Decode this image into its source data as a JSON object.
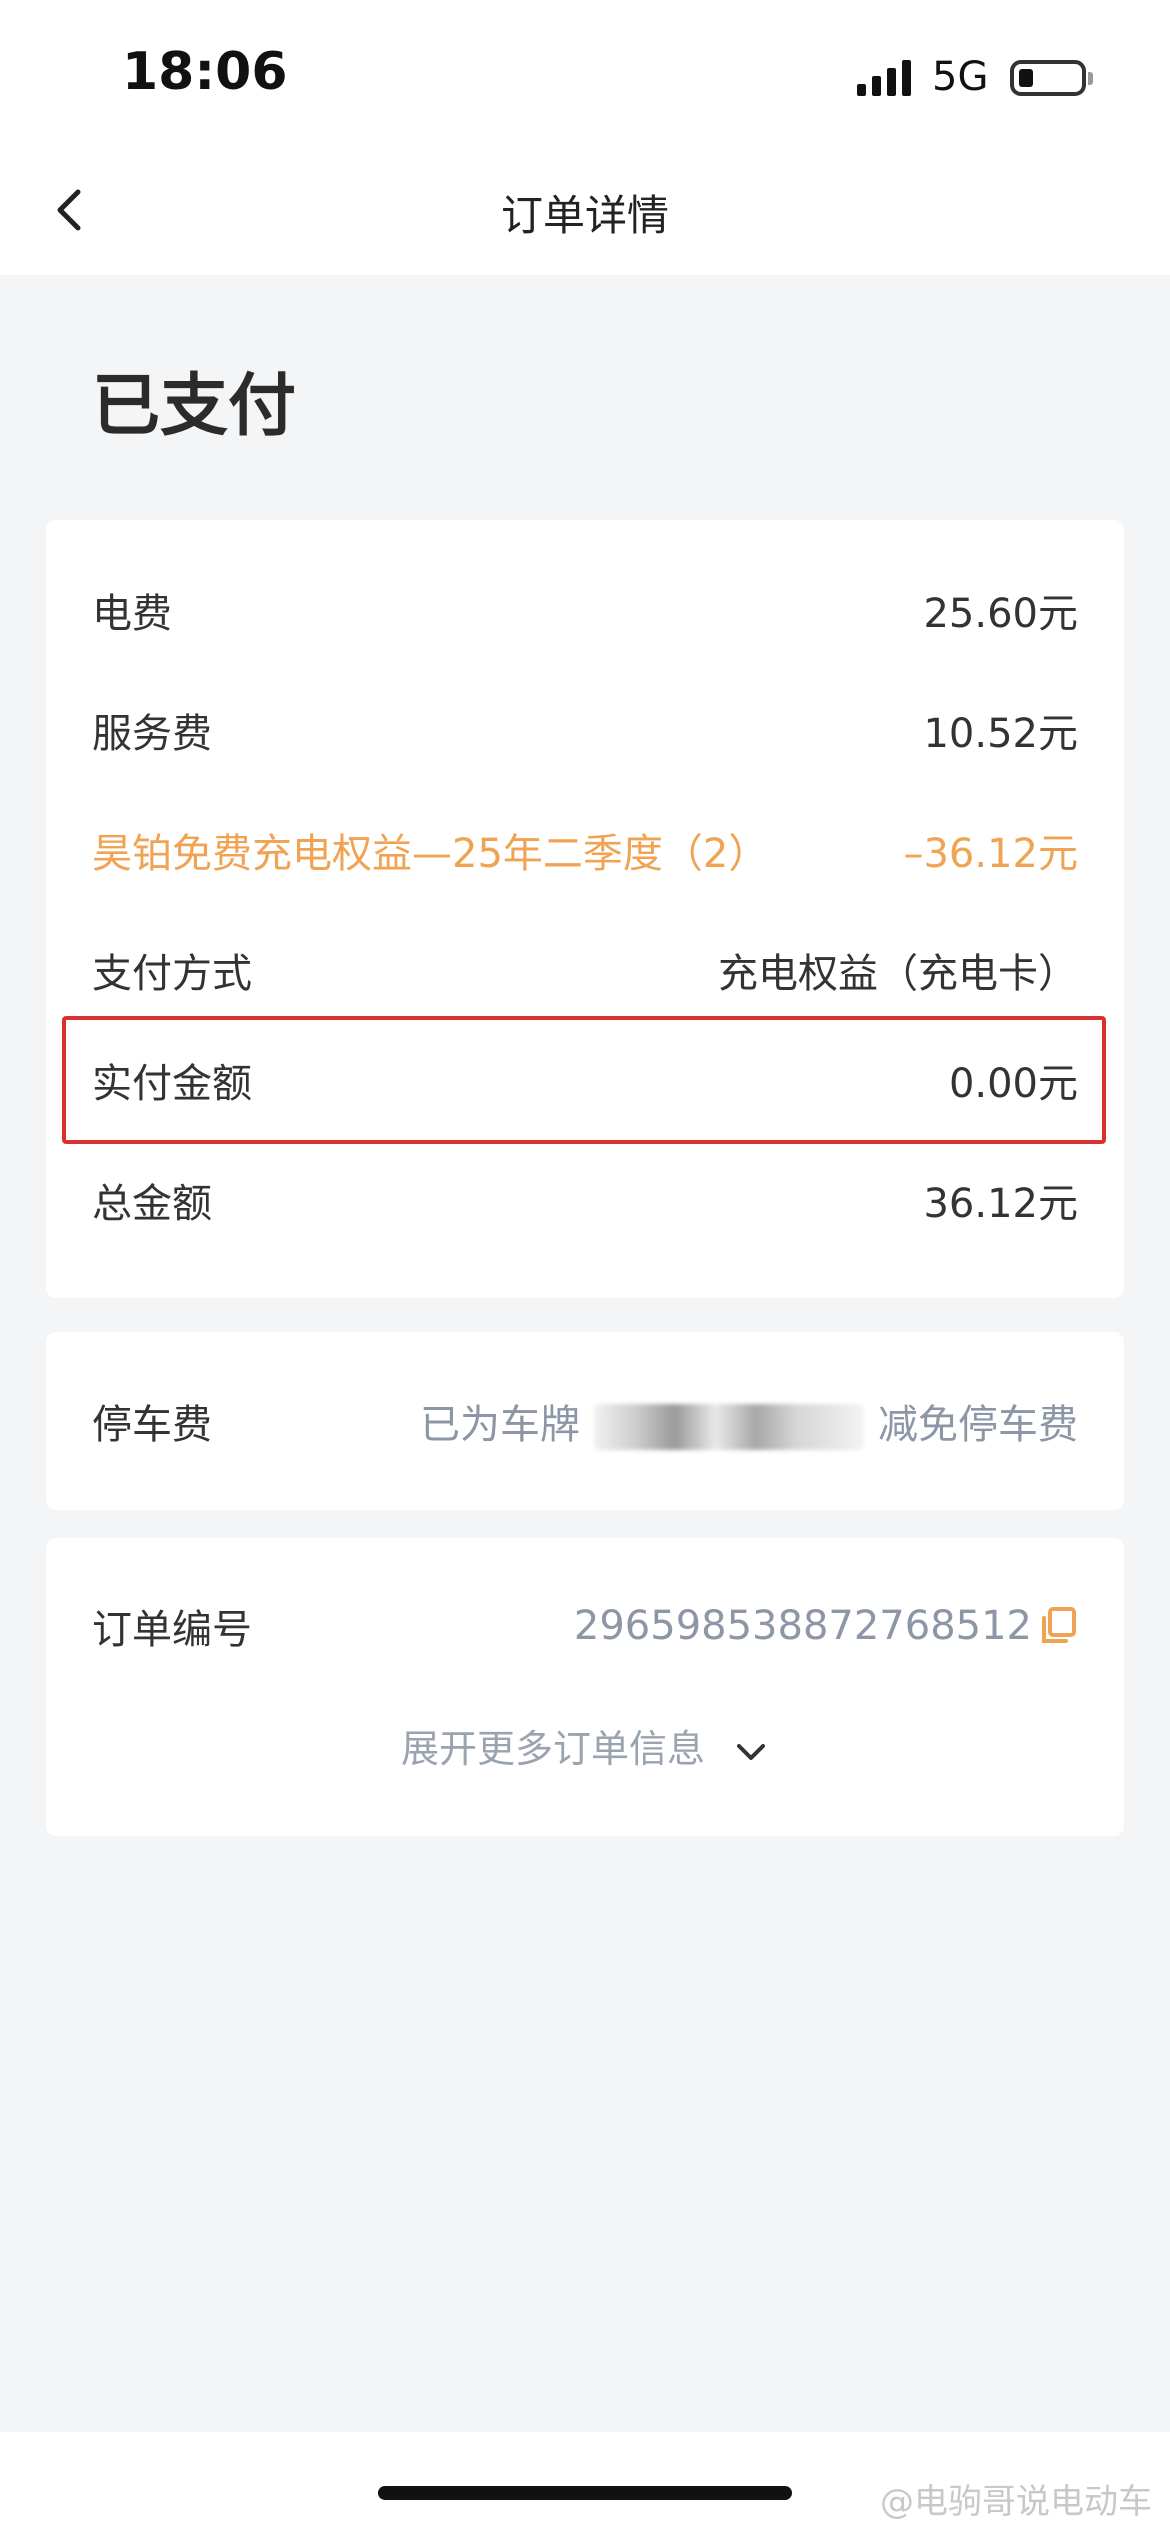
{
  "status_bar": {
    "time": "18:06",
    "network": "5G"
  },
  "nav": {
    "title": "订单详情"
  },
  "order_status": "已支付",
  "fees": {
    "electricity_label": "电费",
    "electricity_value": "25.60元",
    "service_label": "服务费",
    "service_value": "10.52元",
    "discount_label": "昊铂免费充电权益—25年二季度（2）",
    "discount_value": "–36.12元",
    "payment_method_label": "支付方式",
    "payment_method_value": "充电权益（充电卡）",
    "paid_label": "实付金额",
    "paid_value": "0.00元",
    "total_label": "总金额",
    "total_value": "36.12元"
  },
  "parking": {
    "label": "停车费",
    "prefix": "已为车牌",
    "suffix": "减免停车费"
  },
  "order": {
    "number_label": "订单编号",
    "number_value": "2965985388727685​12",
    "expand_label": "展开更多订单信息"
  },
  "watermark": "@电驹哥说电动车",
  "colors": {
    "discount": "#f0a453",
    "highlight": "#d9312f",
    "muted": "#8d96a6"
  }
}
